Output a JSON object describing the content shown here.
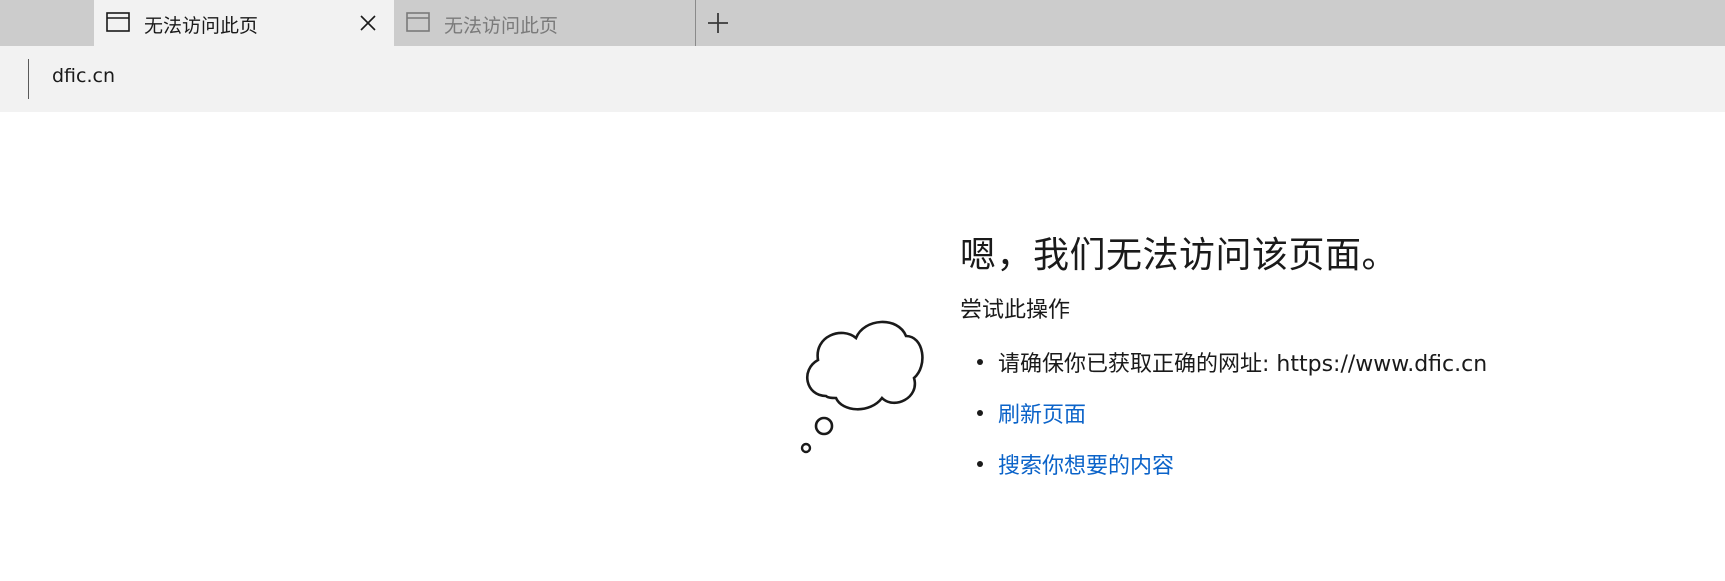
{
  "tabs": [
    {
      "label": "无法访问此页",
      "active": true
    },
    {
      "label": "无法访问此页",
      "active": false
    }
  ],
  "address": {
    "value": "dfic.cn"
  },
  "error": {
    "headline": "嗯，我们无法访问该页面。",
    "subhead": "尝试此操作",
    "suggestions": [
      {
        "text": "请确保你已获取正确的网址: https://www.dfic.cn",
        "link": false
      },
      {
        "text": "刷新页面",
        "link": true
      },
      {
        "text": "搜索你想要的内容",
        "link": true
      }
    ]
  },
  "colors": {
    "tabstrip": "#cccccc",
    "active_tab": "#f2f2f2",
    "link": "#0b63c9"
  },
  "icons": {
    "tab": "page-icon",
    "close": "close-icon",
    "new_tab": "plus-icon",
    "illustration": "thought-cloud-icon"
  }
}
